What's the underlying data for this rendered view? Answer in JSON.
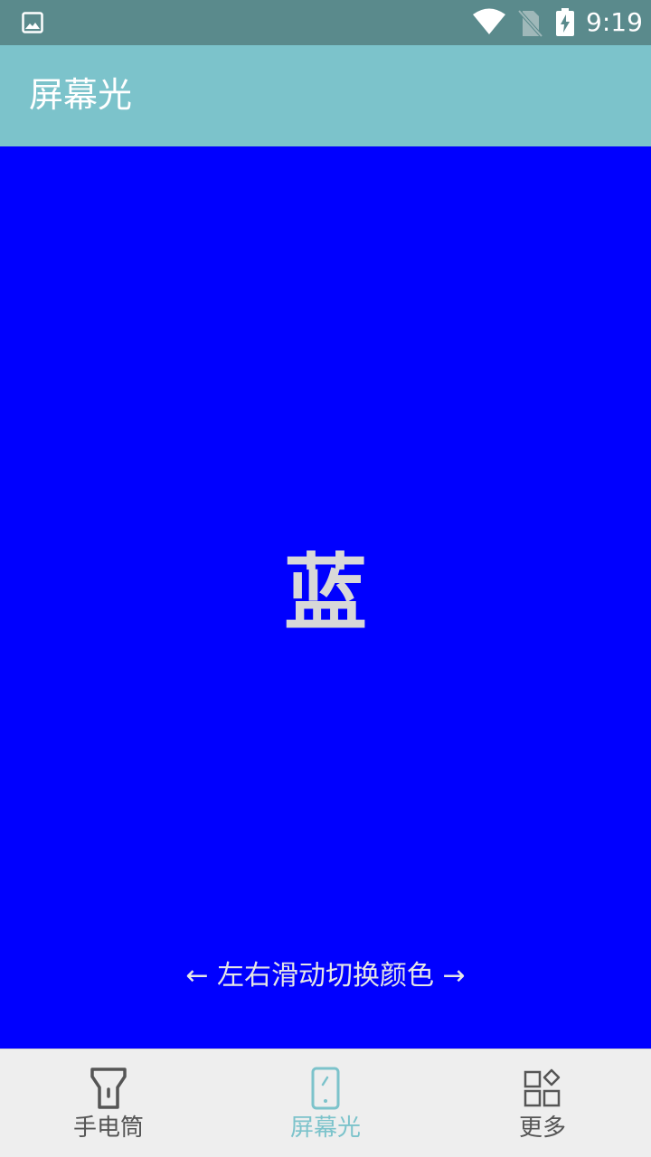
{
  "status_bar": {
    "time": "9:19",
    "icons": [
      "gallery-icon",
      "wifi-icon",
      "no-sim-icon",
      "battery-charging-icon"
    ]
  },
  "app_bar": {
    "title": "屏幕光"
  },
  "color_display": {
    "color_name": "蓝",
    "background_color": "#0000ff",
    "hint": "← 左右滑动切换颜色 →"
  },
  "bottom_nav": {
    "items": [
      {
        "label": "手电筒",
        "icon": "flashlight-icon",
        "active": false
      },
      {
        "label": "屏幕光",
        "icon": "phone-screen-icon",
        "active": true
      },
      {
        "label": "更多",
        "icon": "more-apps-icon",
        "active": false
      }
    ],
    "active_color": "#7cc3cb",
    "inactive_color": "#555555"
  },
  "colors": {
    "status_bar": "#5a8a8c",
    "app_bar": "#7cc3cb",
    "nav_background": "#eeeeee"
  }
}
